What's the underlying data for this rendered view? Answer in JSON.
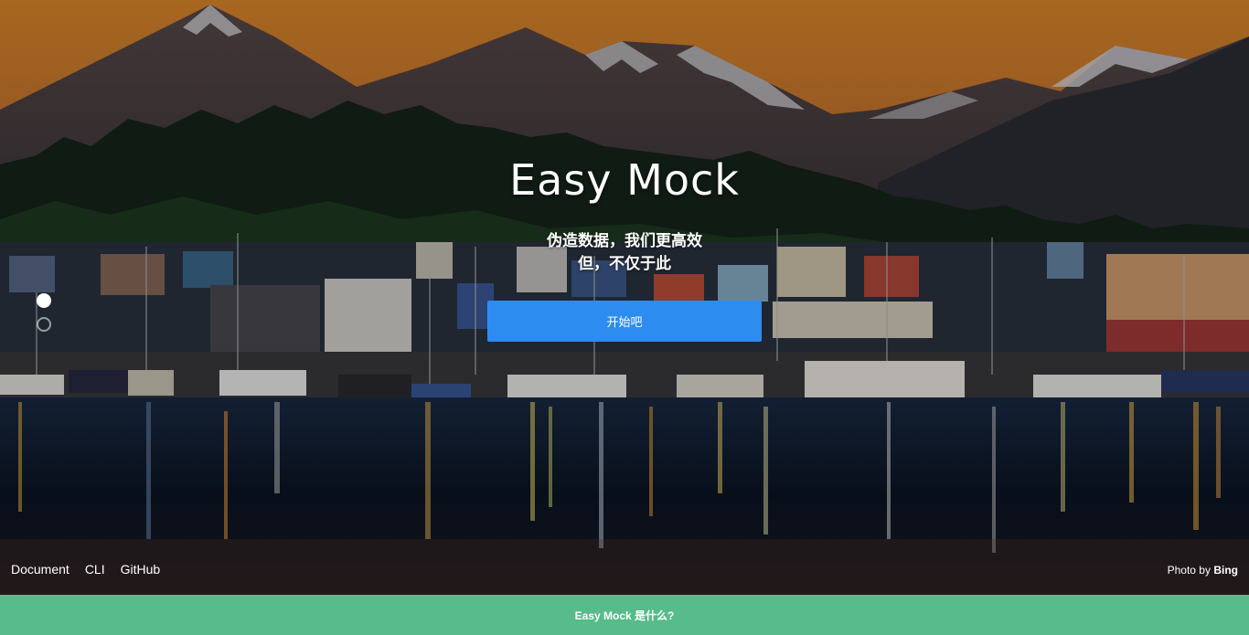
{
  "hero": {
    "title": "Easy Mock",
    "tagline_line1": "伪造数据，我们更高效",
    "tagline_line2": "但，不仅于此",
    "start_button": "开始吧",
    "background_image": "mountain-harbor-sunset-photo"
  },
  "slider": {
    "dots": [
      "active",
      "inactive"
    ]
  },
  "footer": {
    "links": [
      "Document",
      "CLI",
      "GitHub"
    ],
    "photo_by_label": "Photo by",
    "photo_source": "Bing"
  },
  "bottom_bar": {
    "label": "Easy Mock 是什么?"
  },
  "colors": {
    "primary_button": "#2d8cf0",
    "bottom_bar": "#57bb8a",
    "sky_top": "#e08a2a",
    "text": "#ffffff"
  }
}
